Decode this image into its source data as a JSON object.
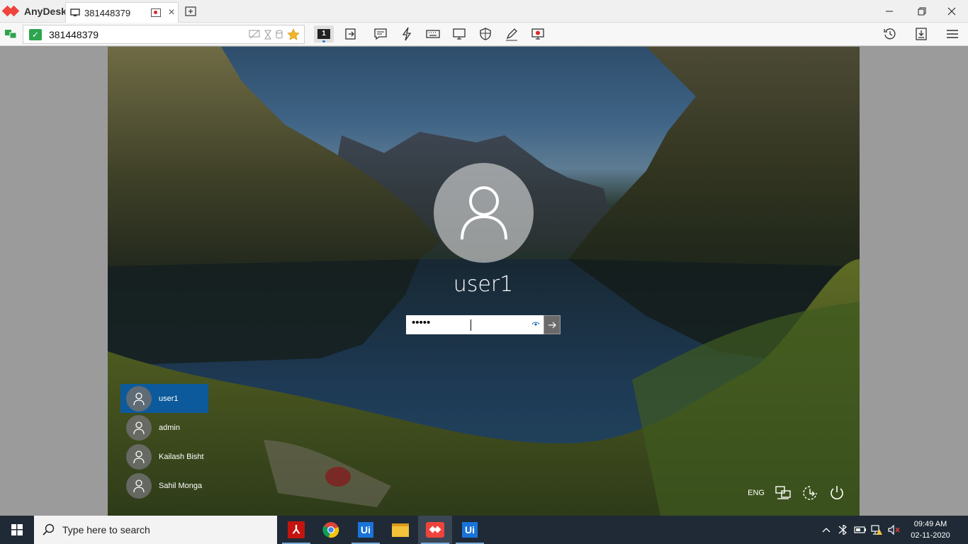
{
  "app": {
    "brand": "AnyDesk"
  },
  "tab": {
    "label": "381448379"
  },
  "toolbar": {
    "address": "381448379",
    "monitor_number": "1"
  },
  "lockscreen": {
    "username": "user1",
    "password_value": "•••••",
    "users": [
      "user1",
      "admin",
      "Kailash Bisht",
      "Sahil Monga"
    ],
    "language": "ENG"
  },
  "taskbar": {
    "search_placeholder": "Type here to search",
    "apps": [
      "acrobat-icon",
      "chrome-icon",
      "uipath-icon",
      "file-explorer-icon",
      "anydesk-icon",
      "uipath-icon"
    ],
    "uipath_label": "Ui",
    "time": "09:49 AM",
    "date": "02-11-2020"
  },
  "colors": {
    "anydesk_red": "#ef443b",
    "selected_user": "#0c5a9c",
    "taskbar_bg": "#1f2a36",
    "uipath_blue": "#1a73d9"
  }
}
